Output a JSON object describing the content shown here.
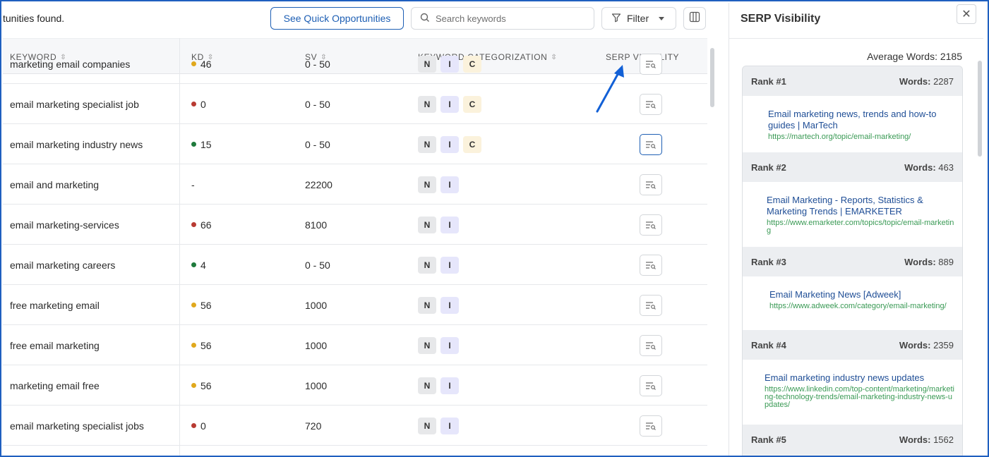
{
  "toolbar": {
    "found_text": "tunities found.",
    "quick_label": "See Quick Opportunities",
    "search_placeholder": "Search keywords",
    "filter_label": "Filter"
  },
  "table": {
    "headers": {
      "keyword": "KEYWORD",
      "kd": "KD",
      "sv": "SV",
      "categorization": "KEYWORD CATEGORIZATION",
      "serp": "SERP VISIBILITY"
    },
    "rows": [
      {
        "keyword": "marketing email companies",
        "kd": "46",
        "kd_color": "#e0a81c",
        "sv": "0 - 50",
        "tags": [
          "N",
          "I",
          "C"
        ]
      },
      {
        "keyword": "email marketing specialist job",
        "kd": "0",
        "kd_color": "#b83a32",
        "sv": "0 - 50",
        "tags": [
          "N",
          "I",
          "C"
        ]
      },
      {
        "keyword": "email marketing industry news",
        "kd": "15",
        "kd_color": "#1e7a3c",
        "sv": "0 - 50",
        "tags": [
          "N",
          "I",
          "C"
        ],
        "active": true
      },
      {
        "keyword": "email and marketing",
        "kd": "-",
        "kd_color": "",
        "sv": "22200",
        "tags": [
          "N",
          "I"
        ]
      },
      {
        "keyword": "email marketing-services",
        "kd": "66",
        "kd_color": "#b83a32",
        "sv": "8100",
        "tags": [
          "N",
          "I"
        ]
      },
      {
        "keyword": "email marketing careers",
        "kd": "4",
        "kd_color": "#1e7a3c",
        "sv": "0 - 50",
        "tags": [
          "N",
          "I"
        ]
      },
      {
        "keyword": "free marketing email",
        "kd": "56",
        "kd_color": "#e0a81c",
        "sv": "1000",
        "tags": [
          "N",
          "I"
        ]
      },
      {
        "keyword": "free email marketing",
        "kd": "56",
        "kd_color": "#e0a81c",
        "sv": "1000",
        "tags": [
          "N",
          "I"
        ]
      },
      {
        "keyword": "marketing email free",
        "kd": "56",
        "kd_color": "#e0a81c",
        "sv": "1000",
        "tags": [
          "N",
          "I"
        ]
      },
      {
        "keyword": "email marketing specialist jobs",
        "kd": "0",
        "kd_color": "#b83a32",
        "sv": "720",
        "tags": [
          "N",
          "I"
        ]
      }
    ]
  },
  "panel": {
    "title": "SERP Visibility",
    "avg_label": "Average Words: 2185",
    "words_label": "Words:",
    "ranks": [
      {
        "rank": "Rank #1",
        "words": "2287",
        "title": "Email marketing news, trends and how-to guides | MarTech",
        "url": "https://martech.org/topic/email-marketing/"
      },
      {
        "rank": "Rank #2",
        "words": "463",
        "title": "Email Marketing - Reports, Statistics & Marketing Trends | EMARKETER",
        "url": "https://www.emarketer.com/topics/topic/email-marketing"
      },
      {
        "rank": "Rank #3",
        "words": "889",
        "title": "Email Marketing News [Adweek]",
        "url": "https://www.adweek.com/category/email-marketing/"
      },
      {
        "rank": "Rank #4",
        "words": "2359",
        "title": "Email marketing industry news updates",
        "url": "https://www.linkedin.com/top-content/marketing/marketing-technology-trends/email-marketing-industry-news-updates/"
      },
      {
        "rank": "Rank #5",
        "words": "1562",
        "title": "",
        "url": ""
      }
    ]
  }
}
